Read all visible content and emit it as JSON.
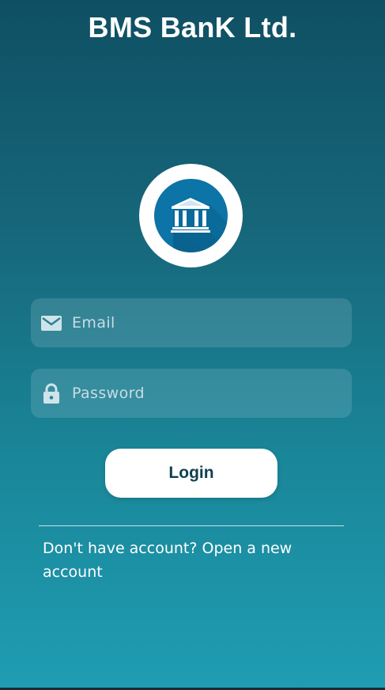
{
  "header": {
    "title": "BMS BanK Ltd."
  },
  "logo": {
    "icon": "bank-icon",
    "ring_color": "#ffffff",
    "circle_color": "#0c74a6"
  },
  "form": {
    "email": {
      "icon": "email-icon",
      "value": "",
      "placeholder": "Email"
    },
    "password": {
      "icon": "lock-icon",
      "value": "",
      "placeholder": "Password"
    },
    "login_label": "Login"
  },
  "footer": {
    "signup_text": "Don't have account? Open a new account"
  },
  "colors": {
    "gradient_top": "#0f4f63",
    "gradient_bottom": "#1f9db2",
    "button_text": "#10404e"
  }
}
